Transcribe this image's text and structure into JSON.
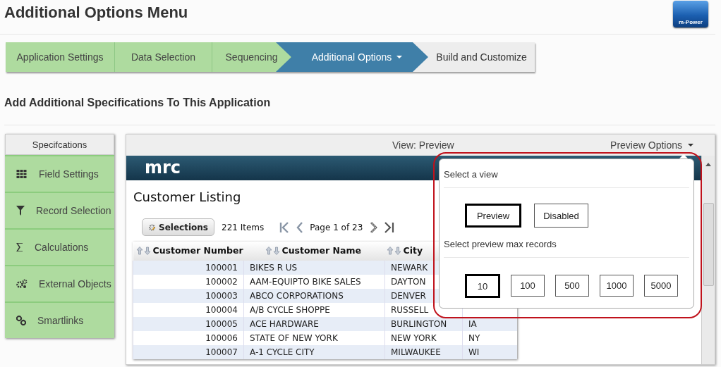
{
  "title": "Additional Options Menu",
  "logo": {
    "label": "m-Power"
  },
  "steps": [
    {
      "label": "Application Settings",
      "completed": true,
      "selected": false
    },
    {
      "label": "Data Selection",
      "completed": true,
      "selected": false
    },
    {
      "label": "Sequencing",
      "completed": true,
      "selected": false
    },
    {
      "label": "Additional Options",
      "completed": false,
      "selected": true
    },
    {
      "label": "Build and Customize",
      "completed": false,
      "selected": false
    }
  ],
  "subtitle": "Add Additional Specifications To This Application",
  "sidebar": {
    "header": "Specifcations",
    "items": [
      {
        "label": "Field Settings"
      },
      {
        "label": "Record Selection"
      },
      {
        "label": "Calculations"
      },
      {
        "label": "External Objects"
      },
      {
        "label": "Smartlinks"
      }
    ]
  },
  "preview": {
    "view_label": "View: Preview",
    "options_label": "Preview Options",
    "app": {
      "logo": "mrc",
      "heading": "Customer Listing",
      "selections_button": "Selections",
      "items_count": "221 Items",
      "page_label": "Page 1 of 23",
      "table": {
        "columns": [
          "Customer Number",
          "Customer Name",
          "City"
        ],
        "rows": [
          [
            "100001",
            "BIKES R US",
            "NEWARK"
          ],
          [
            "100002",
            "AAM-EQUIPTO BIKE SALES",
            "DAYTON"
          ],
          [
            "100003",
            "ABCO CORPORATIONS",
            "DENVER"
          ],
          [
            "100004",
            "A/B CYCLE SHOPPE",
            "RUSSELL"
          ],
          [
            "100005",
            "ACE HARDWARE",
            "BURLINGTON",
            "IA"
          ],
          [
            "100006",
            "STATE OF NEW YORK",
            "NEW YORK",
            "NY"
          ],
          [
            "100007",
            "A-1 CYCLE CITY",
            "MILWAUKEE",
            "WI"
          ]
        ]
      }
    },
    "popup": {
      "view_heading": "Select a view",
      "view_buttons": [
        {
          "label": "Preview",
          "selected": true
        },
        {
          "label": "Disabled",
          "selected": false
        }
      ],
      "records_heading": "Select preview max records",
      "record_buttons": [
        {
          "label": "10",
          "selected": true
        },
        {
          "label": "100",
          "selected": false
        },
        {
          "label": "500",
          "selected": false
        },
        {
          "label": "1000",
          "selected": false
        },
        {
          "label": "5000",
          "selected": false
        }
      ]
    }
  }
}
